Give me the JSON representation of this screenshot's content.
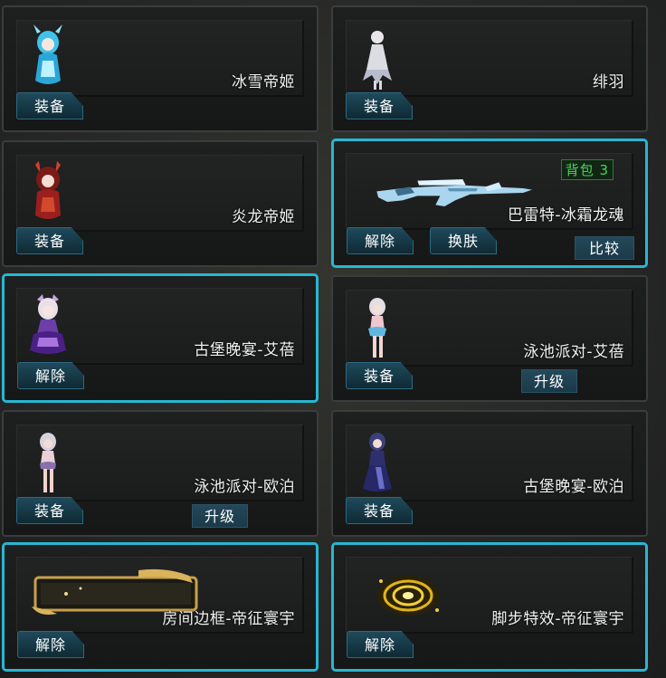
{
  "cards": [
    {
      "name": "冰雪帝姬",
      "primary_button": "装备"
    },
    {
      "name": "绯羽",
      "primary_button": "装备"
    },
    {
      "name": "炎龙帝姬",
      "primary_button": "装备"
    },
    {
      "name": "巴雷特-冰霜龙魂",
      "primary_button": "解除",
      "skin_button": "换肤",
      "compare_button": "比较",
      "badge": "背包 3"
    },
    {
      "name": "古堡晚宴-艾蓓",
      "primary_button": "解除"
    },
    {
      "name": "泳池派对-艾蓓",
      "primary_button": "装备",
      "upgrade_button": "升级"
    },
    {
      "name": "泳池派对-欧泊",
      "primary_button": "装备",
      "upgrade_button": "升级"
    },
    {
      "name": "古堡晚宴-欧泊",
      "primary_button": "装备"
    },
    {
      "name": "房间边框-帝征寰宇",
      "primary_button": "解除"
    },
    {
      "name": "脚步特效-帝征寰宇",
      "primary_button": "解除"
    }
  ],
  "colors": {
    "selected_border": "#27b7d3",
    "button": "#163845",
    "badge_text": "#4bd35a"
  }
}
